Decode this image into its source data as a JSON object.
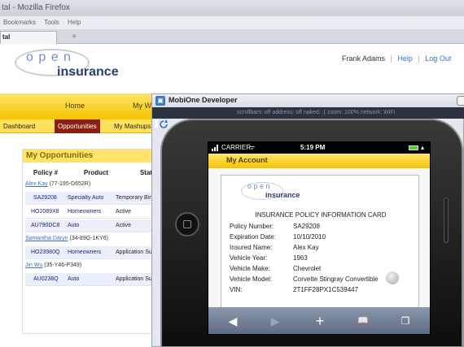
{
  "browser": {
    "title": "tal - Mozilla Firefox",
    "menu": [
      "Bookmarks",
      "Tools",
      "Help"
    ],
    "tab_label": "tal",
    "new_tab": "+"
  },
  "brand": {
    "logo_open": "o p e n",
    "logo_insurance": "insurance"
  },
  "user_nav": {
    "user": "Frank Adams",
    "sep": "|",
    "help": "Help",
    "logout": "Log Out"
  },
  "main_nav": [
    "Home",
    "My Wo"
  ],
  "sub_nav": [
    "Dashboard",
    "Opportunities",
    "My Mashups"
  ],
  "opportunities": {
    "title": "My Opportunities",
    "columns": [
      "Policy #",
      "Product",
      "Stat"
    ],
    "groups": [
      {
        "customer": "Alex Kay",
        "code": "(77-195-D652R)",
        "rows": [
          {
            "policy": "SA29208",
            "product": "Specialty Auto",
            "status": "Temporary Bin"
          },
          {
            "policy": "HO2089X8",
            "product": "Homeowners",
            "status": "Active"
          },
          {
            "policy": "AU790DC8",
            "product": "Auto",
            "status": "Active"
          }
        ]
      },
      {
        "customer": "Samantha Daryn",
        "code": "(34-89G-1KY6)",
        "rows": [
          {
            "policy": "HO23980Q",
            "product": "Homeowners",
            "status": "Application Sul"
          }
        ]
      },
      {
        "customer": "Jin Wu",
        "code": "(35-Y46-P349)",
        "rows": [
          {
            "policy": "AU0238Q",
            "product": "Auto",
            "status": "Application Sul"
          }
        ]
      }
    ]
  },
  "mobione": {
    "title": "MobiOne Developer",
    "status": "scrollbars: off   address: off   naked: :(   zoom: 100%   network: WiFi"
  },
  "phone": {
    "carrier": "CARRIER",
    "time": "5:19 PM",
    "screen_title": "My Account",
    "card": {
      "logo_open": "o p e n",
      "logo_insurance": "insurance",
      "heading": "INSURANCE POLICY INFORMATION CARD",
      "fields": [
        {
          "label": "Policy Number:",
          "value": "SA29208"
        },
        {
          "label": "Expiration Date:",
          "value": "10/10/2010"
        },
        {
          "label": "Insured Name:",
          "value": "Alex Kay"
        },
        {
          "label": "Vehicle Year:",
          "value": "1963"
        },
        {
          "label": "Vehicle Make:",
          "value": "Chevrolet"
        },
        {
          "label": "Vehicle Model:",
          "value": "Corvette Stingray Convertible"
        },
        {
          "label": "VIN:",
          "value": "2T1FF28PX1C539447"
        }
      ]
    },
    "toolbar_icons": [
      "back-icon",
      "forward-icon",
      "add-icon",
      "bookmarks-icon",
      "pages-icon"
    ]
  }
}
